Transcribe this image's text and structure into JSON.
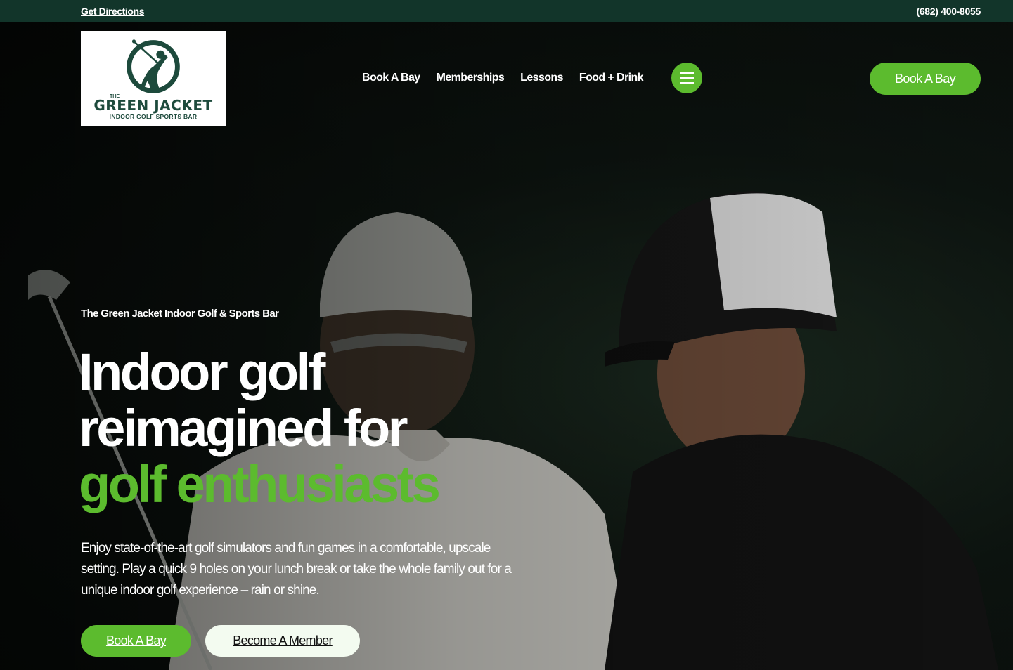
{
  "topbar": {
    "directions_label": "Get Directions",
    "phone": "(682) 400-8055"
  },
  "logo": {
    "the": "THE",
    "brand": "GREEN JACKET",
    "subtitle": "INDOOR GOLF SPORTS BAR"
  },
  "nav": {
    "items": [
      {
        "label": "Book A Bay"
      },
      {
        "label": "Memberships"
      },
      {
        "label": "Lessons"
      },
      {
        "label": "Food + Drink"
      }
    ],
    "menu_icon": "hamburger-icon"
  },
  "header_cta": {
    "label": "Book A Bay"
  },
  "hero": {
    "eyebrow": "The Green Jacket Indoor Golf & Sports Bar",
    "headline_line1": "Indoor golf",
    "headline_line2": "reimagined for",
    "headline_line3": "golf enthusiasts",
    "description": "Enjoy state-of-the-art golf simulators and fun games in a comfortable, upscale setting. Play a quick 9 holes on your lunch break or take the whole family out for a unique indoor golf experience – rain or shine.",
    "primary_cta": "Book A Bay",
    "secondary_cta": "Become A Member"
  },
  "colors": {
    "topbar_bg": "#12352a",
    "accent_green": "#5cbb2e",
    "brand_dark_green": "#1d4a3c",
    "secondary_btn_bg": "#f3fbf0"
  }
}
